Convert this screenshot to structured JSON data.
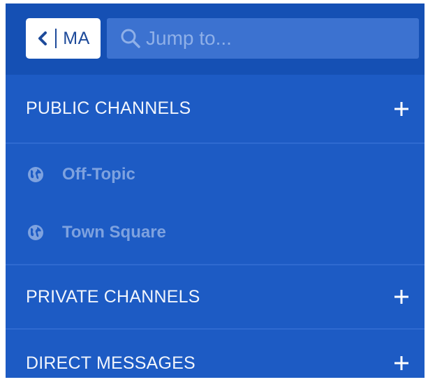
{
  "header": {
    "team_initials": "MA",
    "search_placeholder": "Jump to..."
  },
  "sections": {
    "public": {
      "title": "PUBLIC CHANNELS",
      "channels": [
        {
          "name": "Off-Topic",
          "icon": "globe-icon"
        },
        {
          "name": "Town Square",
          "icon": "globe-icon"
        }
      ]
    },
    "private": {
      "title": "PRIVATE CHANNELS"
    },
    "direct": {
      "title": "DIRECT MESSAGES"
    }
  },
  "colors": {
    "sidebar_bg": "#1d5bc4",
    "header_bg": "#1550b4",
    "search_bg": "#3c72d0",
    "channel_text": "#7ea2df",
    "header_text": "#f1f5fc"
  }
}
